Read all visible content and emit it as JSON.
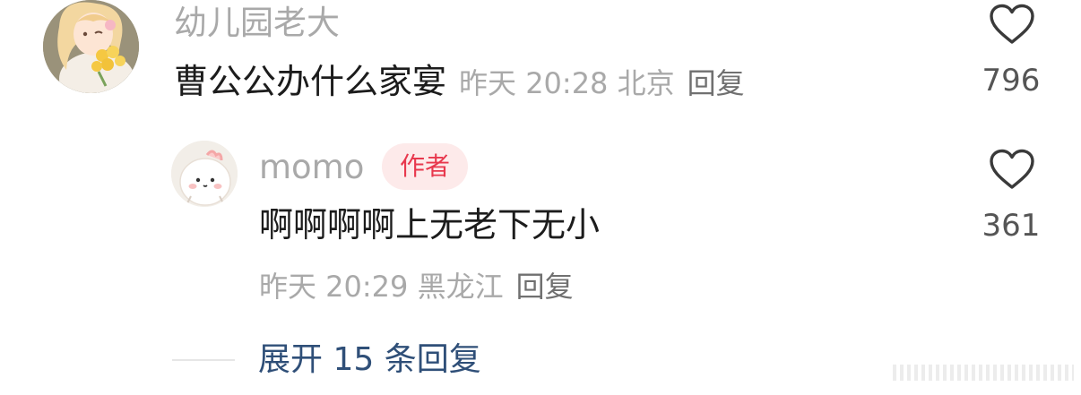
{
  "comment": {
    "username": "幼儿园老大",
    "text": "曹公公办什么家宴",
    "time": "昨天 20:28",
    "location": "北京",
    "reply_label": "回复",
    "likes": "796"
  },
  "reply": {
    "username": "momo",
    "author_badge": "作者",
    "text": "啊啊啊啊上无老下无小",
    "time": "昨天 20:29",
    "location": "黑龙江",
    "reply_label": "回复",
    "likes": "361"
  },
  "expand": {
    "label": "展开 15 条回复"
  },
  "icons": {
    "like": "heart-outline-icon"
  },
  "colors": {
    "primary_text": "#1c1c1c",
    "secondary_text": "#a9a9a9",
    "badge_text": "#e8384d",
    "badge_bg": "#fdeaea",
    "link": "#2f4f78"
  }
}
